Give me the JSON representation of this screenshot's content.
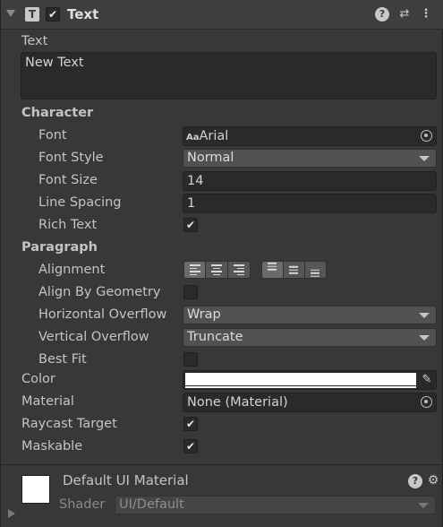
{
  "header": {
    "title": "Text",
    "enabled_check": "✔",
    "icons": [
      "help-icon",
      "preset-icon",
      "more-icon"
    ]
  },
  "text_section": {
    "label": "Text",
    "value": "New Text"
  },
  "character": {
    "heading": "Character",
    "font_label": "Font",
    "font_icon": "Aa",
    "font_value": "Arial",
    "font_style_label": "Font Style",
    "font_style_value": "Normal",
    "font_size_label": "Font Size",
    "font_size_value": "14",
    "line_spacing_label": "Line Spacing",
    "line_spacing_value": "1",
    "rich_text_label": "Rich Text",
    "rich_text_check": "✔"
  },
  "paragraph": {
    "heading": "Paragraph",
    "alignment_label": "Alignment",
    "align_geometry_label": "Align By Geometry",
    "horizontal_overflow_label": "Horizontal Overflow",
    "horizontal_overflow_value": "Wrap",
    "vertical_overflow_label": "Vertical Overflow",
    "vertical_overflow_value": "Truncate",
    "best_fit_label": "Best Fit"
  },
  "color_label": "Color",
  "material_label": "Material",
  "material_value": "None (Material)",
  "raycast_label": "Raycast Target",
  "raycast_check": "✔",
  "maskable_label": "Maskable",
  "maskable_check": "✔",
  "material_preview": {
    "name": "Default UI Material",
    "shader_label": "Shader",
    "shader_value": "UI/Default"
  },
  "colors": {
    "panel_bg": "#383838",
    "field_bg": "#2a2a2a",
    "color_swatch": "#ffffff"
  }
}
